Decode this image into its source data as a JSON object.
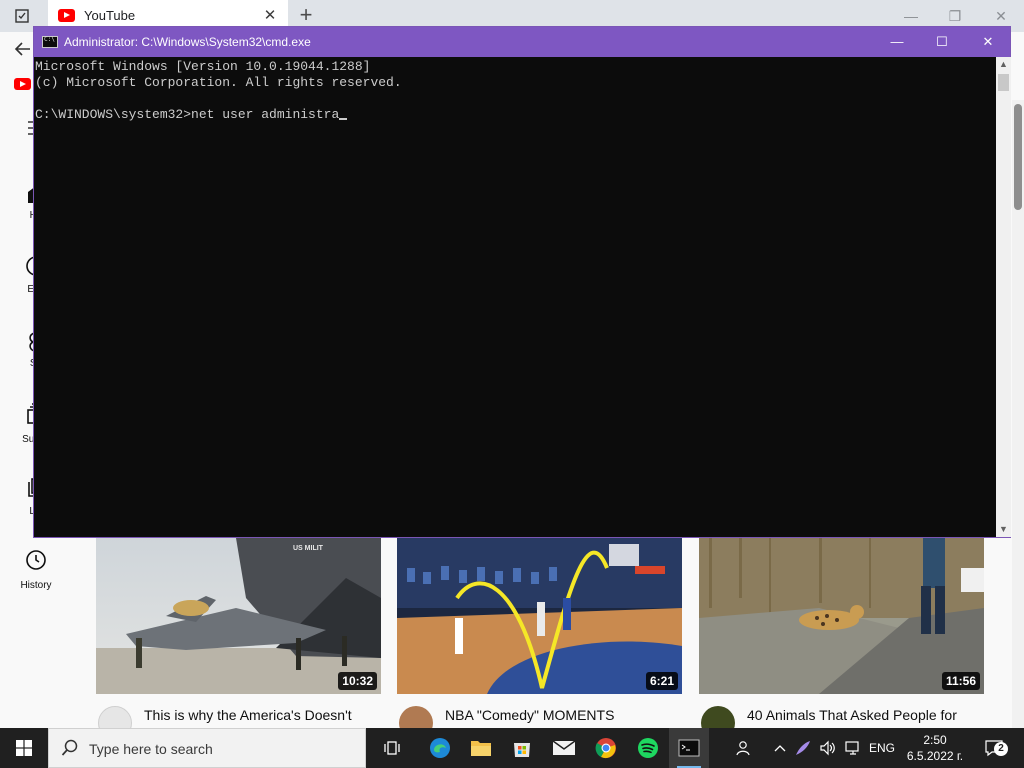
{
  "browser": {
    "tab_title": "YouTube",
    "tab_close": "✕",
    "new_tab": "+",
    "minimize": "—",
    "restore": "❐",
    "close": "✕"
  },
  "youtube": {
    "sidebar": [
      {
        "label": "Ho",
        "icon": "home-icon"
      },
      {
        "label": "Exp",
        "icon": "explore-icon"
      },
      {
        "label": "Sh",
        "icon": "shorts-icon"
      },
      {
        "label": "Subsc",
        "icon": "subscriptions-icon"
      },
      {
        "label": "Lib",
        "icon": "library-icon"
      },
      {
        "label": "History",
        "icon": "history-icon"
      }
    ],
    "videos": [
      {
        "title": "This is why the America's Doesn't",
        "duration": "10:32"
      },
      {
        "title": "NBA \"Comedy\" MOMENTS",
        "duration": "6:21"
      },
      {
        "title": "40 Animals That Asked People for",
        "duration": "11:56"
      }
    ],
    "thumb_text": "US MILIT"
  },
  "cmd": {
    "title": "Administrator: C:\\Windows\\System32\\cmd.exe",
    "lines": [
      "Microsoft Windows [Version 10.0.19044.1288]",
      "(c) Microsoft Corporation. All rights reserved.",
      "",
      "C:\\WINDOWS\\system32>net user administra"
    ],
    "minimize": "—",
    "maximize": "☐",
    "close": "✕",
    "colors": {
      "titlebar": "#7e57c2",
      "console_bg": "#0c0c0c",
      "console_fg": "#cccccc"
    }
  },
  "taskbar": {
    "search_placeholder": "Type here to search",
    "apps": [
      "task-view-icon",
      "edge-icon",
      "file-explorer-icon",
      "microsoft-store-icon",
      "mail-icon",
      "chrome-icon",
      "spotify-icon",
      "cmd-icon"
    ],
    "language": "ENG",
    "time": "2:50",
    "date": "6.5.2022 г.",
    "notification_count": "2"
  }
}
